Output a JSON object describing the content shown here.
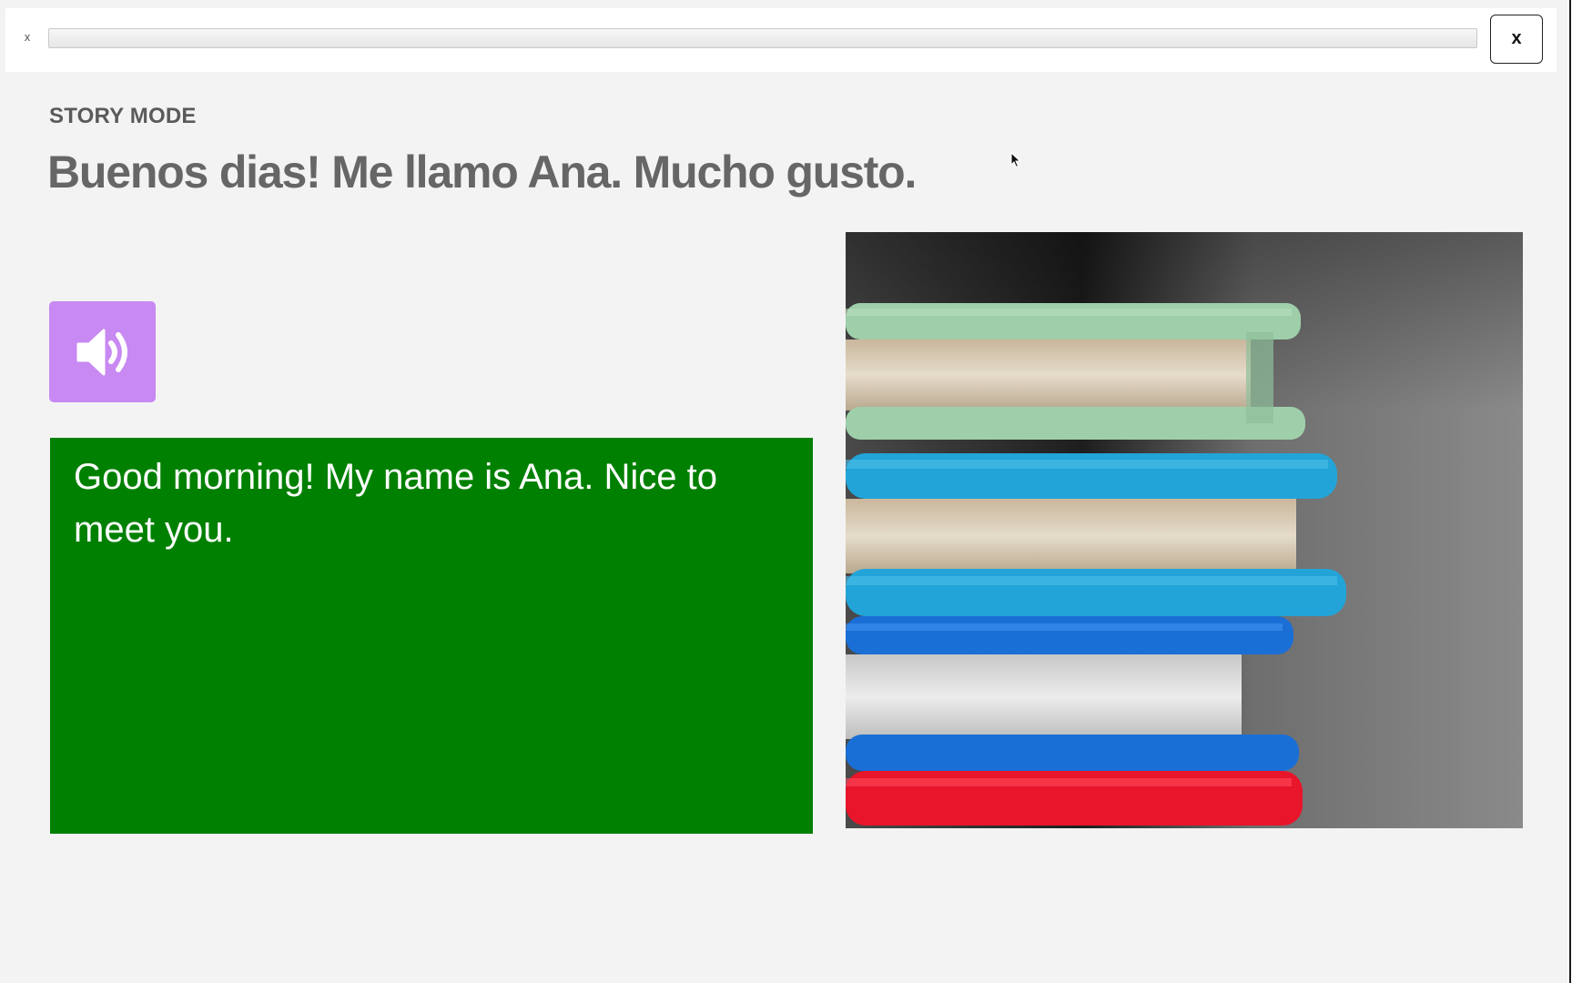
{
  "topbar": {
    "small_close_label": "x",
    "progress_fraction": 0.0,
    "close_label": "x"
  },
  "lesson": {
    "mode_label": "STORY MODE",
    "sentence": "Buenos dias! Me llamo Ana. Mucho gusto.",
    "translation": "Good morning! My name is Ana. Nice to meet you.",
    "audio_icon": "speaker-icon",
    "image_icon": "stacked-books-photo"
  },
  "colors": {
    "background": "#f3f3f3",
    "audio_button": "#c889f2",
    "translation_box": "#008000",
    "title_text": "#666666"
  }
}
